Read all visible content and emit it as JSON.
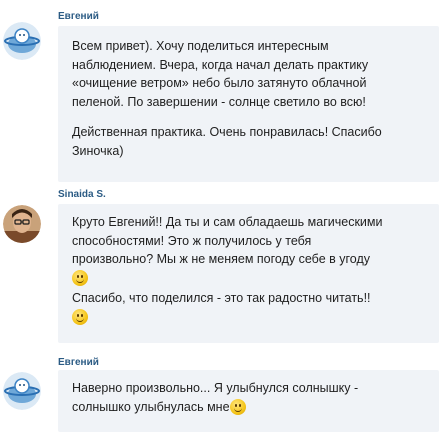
{
  "messages": [
    {
      "author": "Евгений",
      "avatar_icon": "planet-avatar-icon",
      "paragraphs": [
        [
          "Всем привет). Хочу поделиться интересным",
          "наблюдением. Вчера, когда начал делать практику",
          "«очищение ветром» небо было затянуто облачной",
          "пеленой. По завершении - солнце светило во всю!"
        ],
        [
          "Действенная практика. Очень понравилась! Спасибо",
          "Зиночка)"
        ]
      ]
    },
    {
      "author": "Sinaida S.",
      "avatar_icon": "user-photo-avatar",
      "paragraphs": [
        [
          "Круто Евгений!! Да ты и сам обладаешь магическими",
          "способностями! Это ж получилось у тебя",
          "произвольно? Мы ж не меняем погоду себе в угоду"
        ],
        [
          "Спасибо, что поделился - это так радостно читать!!"
        ]
      ]
    },
    {
      "author": "Евгений",
      "avatar_icon": "planet-avatar-icon",
      "paragraphs": [
        [
          "Наверно произвольно... Я улыбнулся солнышку -",
          "солнышко улыбнулась мне"
        ]
      ]
    }
  ]
}
